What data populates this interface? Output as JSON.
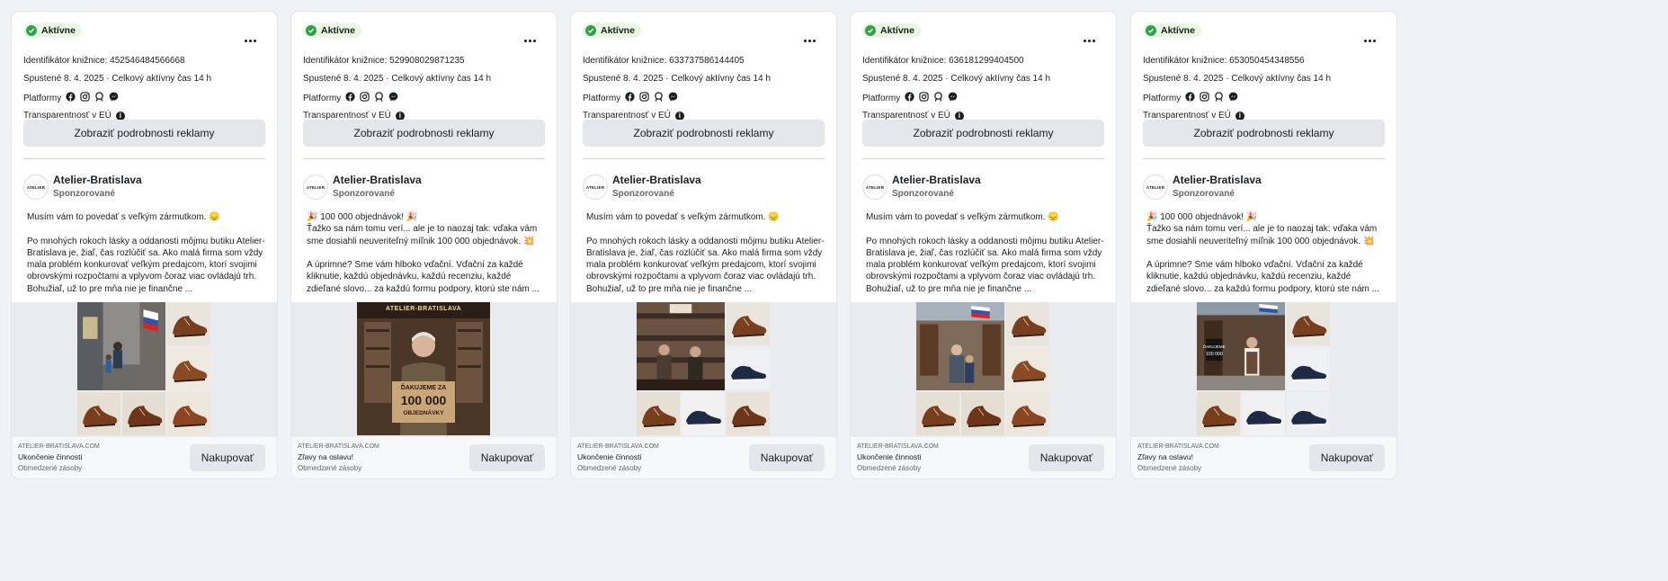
{
  "colors": {
    "active_green": "#31a24c",
    "active_bg": "#e9f6e2",
    "button_bg": "#e4e6eb",
    "page_bg": "#f0f2f5"
  },
  "common": {
    "status_label": "Aktívne",
    "launched": "Spustené 8. 4. 2025 · Celkový aktívny čas 14 h",
    "platforms_label": "Platformy",
    "platform_icons": [
      "facebook-icon",
      "instagram-icon",
      "audience-network-icon",
      "messenger-icon"
    ],
    "eu_transparency_label": "Transparentnosť v EÚ",
    "details_button": "Zobraziť podrobnosti reklamy",
    "page_name": "Atelier-Bratislava",
    "avatar_text": "ATELIER",
    "sponsored": "Sponzorované",
    "domain": "ATELIER-BRATISLAVA.COM",
    "subline": "Obmedzené zásoby",
    "cta": "Nakupovať"
  },
  "cards": [
    {
      "library_id": "Identifikátor knižnice: 452546484566668",
      "body": "Musím vám to povedať s veľkým zármutkom. 😞\n\nPo mnohých rokoch lásky a oddanosti môjmu butiku Atelier-Bratislava je, žiaľ, čas rozlúčiť sa. Ako malá firma som vždy mala problém konkurovať veľkým predajcom, ktorí svojimi obrovskými rozpočtami a vplyvom čoraz viac ovládajú trh. Bohužiaľ, už to pre mňa nie je finančne ...",
      "footer_title": "Ukončenie činnosti",
      "media": "collage-street"
    },
    {
      "library_id": "Identifikátor knižnice: 529908029871235",
      "body": "🎉 100 000 objednávok! 🎉\nŤažko sa nám tomu verí... ale je to naozaj tak: vďaka vám sme dosiahli neuveriteľný míľnik 100 000 objednávok. 💥\n\nA úprimne? Sme vám hlboko vďační. Vďační za každé kliknutie, každú objednávku, každú recenziu, každé zdieľané slovo... za každú formu podpory, ktorú ste nám ...",
      "footer_title": "Zľavy na oslavu!",
      "media": "single-sign",
      "image_texts": [
        "ATELIER-BRATISLAVA",
        "ĎAKUJEME ZA",
        "100 000",
        "OBJEDNÁVKY"
      ]
    },
    {
      "library_id": "Identifikátor knižnice: 633737586144405",
      "body": "Musím vám to povedať s veľkým zármutkom. 😞\n\nPo mnohých rokoch lásky a oddanosti môjmu butiku Atelier-Bratislava je, žiaľ, čas rozlúčiť sa. Ako malá firma som vždy mala problém konkurovať veľkým predajcom, ktorí svojimi obrovskými rozpočtami a vplyvom čoraz viac ovládajú trh. Bohužiaľ, už to pre mňa nie je finančne ...",
      "footer_title": "Ukončenie činnosti",
      "media": "collage-shop"
    },
    {
      "library_id": "Identifikátor knižnice: 636181299404500",
      "body": "Musím vám to povedať s veľkým zármutkom. 😞\n\nPo mnohých rokoch lásky a oddanosti môjmu butiku Atelier-Bratislava je, žiaľ, čas rozlúčiť sa. Ako malá firma som vždy mala problém konkurovať veľkým predajcom, ktorí svojimi obrovskými rozpočtami a vplyvom čoraz viac ovládajú trh. Bohužiaľ, už to pre mňa nie je finančne ...",
      "footer_title": "Ukončenie činnosti",
      "media": "collage-owner"
    },
    {
      "library_id": "Identifikátor knižnice: 653050454348556",
      "body": "🎉 100 000 objednávok! 🎉\nŤažko sa nám tomu verí... ale je to naozaj tak: vďaka vám sme dosiahli neuveriteľný míľnik 100 000 objednávok. 💥\n\nA úprimne? Sme vám hlboko vďační. Vďační za každé kliknutie, každú objednávku, každú recenziu, každé zdieľané slovo... za každú formu podpory, ktorú ste nám ...",
      "footer_title": "Zľavy na oslavu!",
      "media": "collage-sign"
    }
  ]
}
